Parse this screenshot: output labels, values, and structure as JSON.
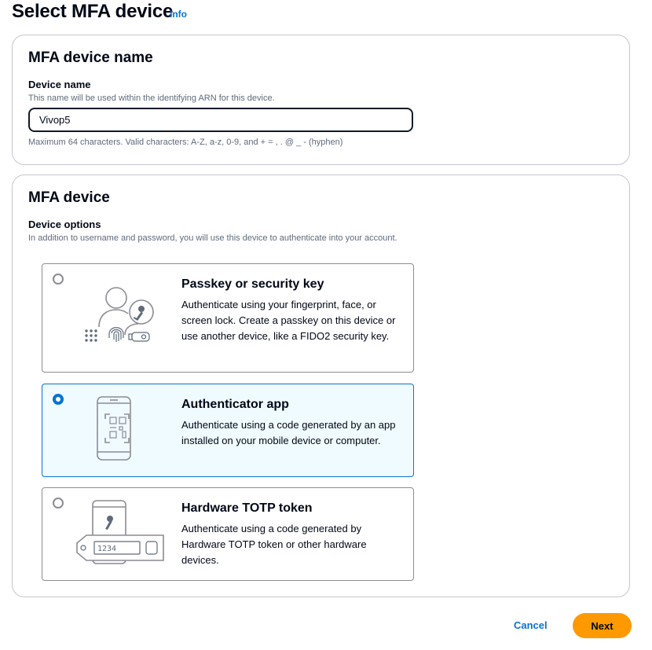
{
  "page": {
    "title": "Select MFA device",
    "info_label": "Info"
  },
  "name_section": {
    "title": "MFA device name",
    "field_label": "Device name",
    "field_description": "This name will be used within the identifying ARN for this device.",
    "field_value": "Vivop5",
    "constraint": "Maximum 64 characters. Valid characters: A-Z, a-z, 0-9, and + = , . @ _ - (hyphen)"
  },
  "device_section": {
    "title": "MFA device",
    "options_label": "Device options",
    "options_description": "In addition to username and password, you will use this device to authenticate into your account.",
    "options": [
      {
        "title": "Passkey or security key",
        "description": "Authenticate using your fingerprint, face, or screen lock. Create a passkey on this device or use another device, like a FIDO2 security key.",
        "icon": "passkey-icon",
        "selected": false
      },
      {
        "title": "Authenticator app",
        "description": "Authenticate using a code generated by an app installed on your mobile device or computer.",
        "icon": "authenticator-app-icon",
        "selected": true
      },
      {
        "title": "Hardware TOTP token",
        "description": "Authenticate using a code generated by Hardware TOTP token or other hardware devices.",
        "icon": "hardware-token-icon",
        "token_display": "1234",
        "selected": false
      }
    ]
  },
  "actions": {
    "cancel_label": "Cancel",
    "next_label": "Next"
  },
  "colors": {
    "accent": "#0972d3",
    "primary_button": "#ff9900",
    "selected_bg": "#f0fbff",
    "text": "#000716",
    "muted_text": "#5f6b7a"
  }
}
